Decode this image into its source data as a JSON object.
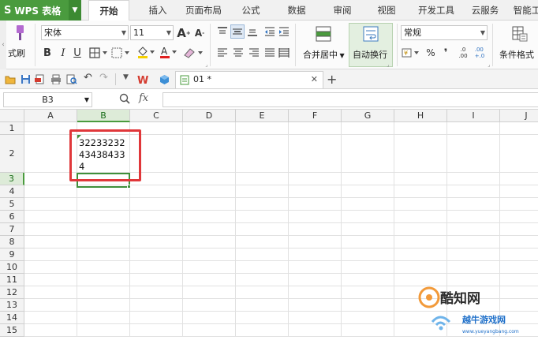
{
  "app": {
    "name": "WPS 表格",
    "logo": "S"
  },
  "tabs": [
    {
      "label": "开始",
      "active": true
    },
    {
      "label": "插入"
    },
    {
      "label": "页面布局"
    },
    {
      "label": "公式"
    },
    {
      "label": "数据"
    },
    {
      "label": "审阅"
    },
    {
      "label": "视图"
    },
    {
      "label": "开发工具"
    },
    {
      "label": "云服务"
    },
    {
      "label": "智能工"
    }
  ],
  "ribbon": {
    "format_painter_label": "式刷",
    "font_name": "宋体",
    "font_size": "11",
    "bold": "B",
    "italic": "I",
    "underline": "U",
    "grow_font": "A",
    "shrink_font": "A",
    "merge_center_label": "合并居中",
    "wrap_text_label": "自动换行",
    "number_format": "常规",
    "percent": "%",
    "comma": "❜",
    "inc_decimal": ".0\n.00",
    "conditional_format_label": "条件格式"
  },
  "document": {
    "tab_label": "01 *"
  },
  "formula_bar": {
    "cell_ref": "B3",
    "fx": "fx",
    "value": ""
  },
  "columns": [
    "A",
    "B",
    "C",
    "D",
    "E",
    "F",
    "G",
    "H",
    "I",
    "J"
  ],
  "rows": [
    "1",
    "2",
    "3",
    "4",
    "5",
    "6",
    "7",
    "8",
    "9",
    "10",
    "11",
    "12",
    "13",
    "14",
    "15"
  ],
  "selected_cell": {
    "column": "B",
    "row": "3"
  },
  "cells": {
    "B2": [
      "32233232",
      "43438433",
      "4"
    ]
  },
  "watermark": {
    "brand": "酷知网",
    "site": "www.yueyangbang.com",
    "sub": "越牛游戏网"
  },
  "colors": {
    "wps_green": "#4a9b3e",
    "highlight_red": "#e0373a",
    "selection_green": "#3f8f3a"
  }
}
